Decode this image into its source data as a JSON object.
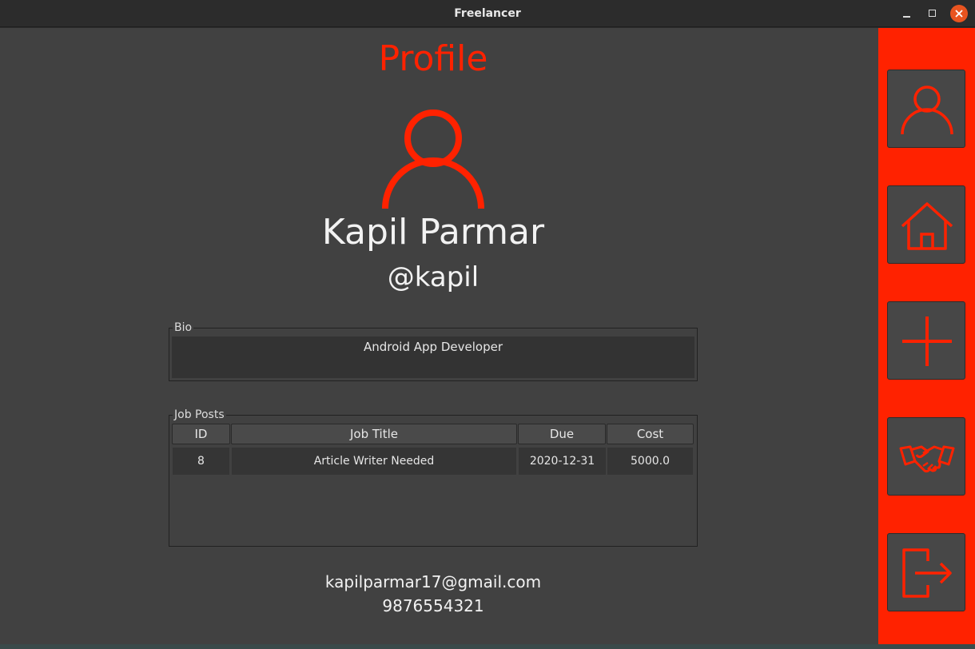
{
  "window": {
    "title": "Freelancer"
  },
  "profile": {
    "heading": "Profile",
    "name": "Kapil Parmar",
    "handle": "@kapil"
  },
  "bio": {
    "label": "Bio",
    "text": "Android App Developer"
  },
  "jobs": {
    "label": "Job Posts",
    "columns": [
      "ID",
      "Job Title",
      "Due",
      "Cost"
    ],
    "rows": [
      [
        "8",
        "Article Writer Needed",
        "2020-12-31",
        "5000.0"
      ]
    ]
  },
  "contact": {
    "email": "kapilparmar17@gmail.com",
    "phone": "9876554321"
  },
  "sidebar": {
    "items": [
      {
        "icon": "user-icon"
      },
      {
        "icon": "home-icon"
      },
      {
        "icon": "plus-icon"
      },
      {
        "icon": "handshake-icon"
      },
      {
        "icon": "logout-icon"
      }
    ]
  },
  "colors": {
    "accent": "#ff2200",
    "panel": "#414141",
    "button": "#474747"
  }
}
